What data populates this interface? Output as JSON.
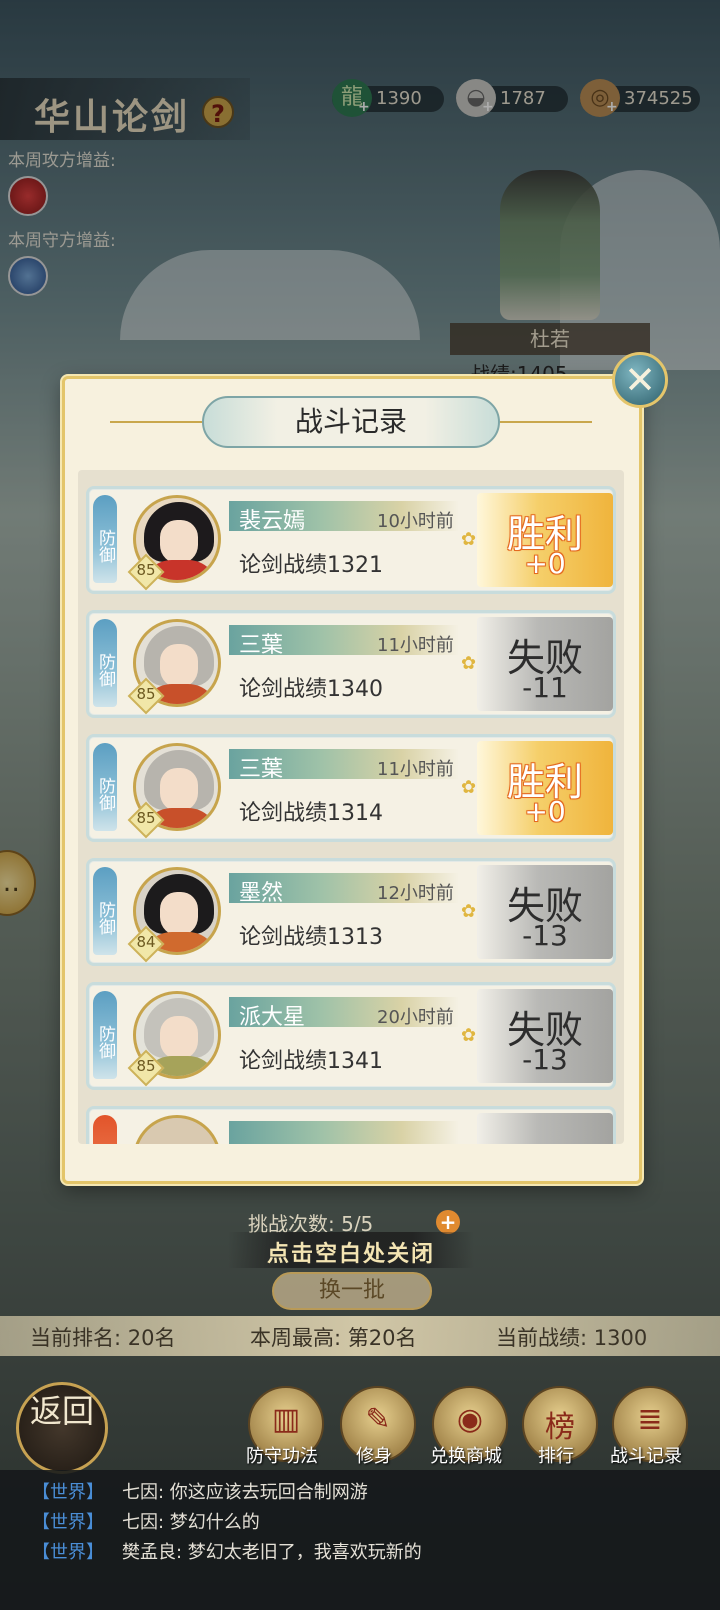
{
  "header": {
    "title": "华山论剑",
    "help_icon": "question-icon",
    "resources": [
      {
        "icon": "jade-dragon-icon",
        "value": "1390"
      },
      {
        "icon": "silver-ingot-icon",
        "value": "1787"
      },
      {
        "icon": "coin-pile-icon",
        "value": "374525"
      }
    ]
  },
  "buffs": {
    "attack_label": "本周攻方增益:",
    "defense_label": "本周守方增益:"
  },
  "npc": {
    "name": "杜若",
    "score_partial": "战绩:1405"
  },
  "modal": {
    "title": "战斗记录",
    "close_icon": "close-icon",
    "records": [
      {
        "side": "防御",
        "name": "裴云嫣",
        "time": "10小时前",
        "score": "论剑战绩1321",
        "level": "85",
        "result": "胜利",
        "delta": "+0",
        "outcome": "win"
      },
      {
        "side": "防御",
        "name": "三葉",
        "time": "11小时前",
        "score": "论剑战绩1340",
        "level": "85",
        "result": "失败",
        "delta": "-11",
        "outcome": "lose"
      },
      {
        "side": "防御",
        "name": "三葉",
        "time": "11小时前",
        "score": "论剑战绩1314",
        "level": "85",
        "result": "胜利",
        "delta": "+0",
        "outcome": "win"
      },
      {
        "side": "防御",
        "name": "墨然",
        "time": "12小时前",
        "score": "论剑战绩1313",
        "level": "84",
        "result": "失败",
        "delta": "-13",
        "outcome": "lose"
      },
      {
        "side": "防御",
        "name": "派大星",
        "time": "20小时前",
        "score": "论剑战绩1341",
        "level": "85",
        "result": "失败",
        "delta": "-13",
        "outcome": "lose"
      }
    ]
  },
  "challenge": {
    "label": "挑战次数: 5/5",
    "plus": "+"
  },
  "click_close": "点击空白处关闭",
  "refresh": "换一批",
  "stats": {
    "rank": "当前排名: 20名",
    "weekly_best": "本周最高: 第20名",
    "current_score": "当前战绩: 1300"
  },
  "bottom_menu": {
    "back": "返回",
    "items": [
      {
        "label": "防守功法",
        "icon": "book-icon"
      },
      {
        "label": "修身",
        "icon": "scroll-icon"
      },
      {
        "label": "兑换商城",
        "icon": "shop-icon"
      },
      {
        "label": "排行",
        "icon": "ranking-icon"
      },
      {
        "label": "战斗记录",
        "icon": "battle-record-icon"
      }
    ]
  },
  "chat": [
    {
      "channel": "【世界】",
      "text": "七因: 你这应该去玩回合制网游"
    },
    {
      "channel": "【世界】",
      "text": "七因: 梦幻什么的"
    },
    {
      "channel": "【世界】",
      "text": "樊孟良: 梦幻太老旧了，我喜欢玩新的"
    }
  ]
}
